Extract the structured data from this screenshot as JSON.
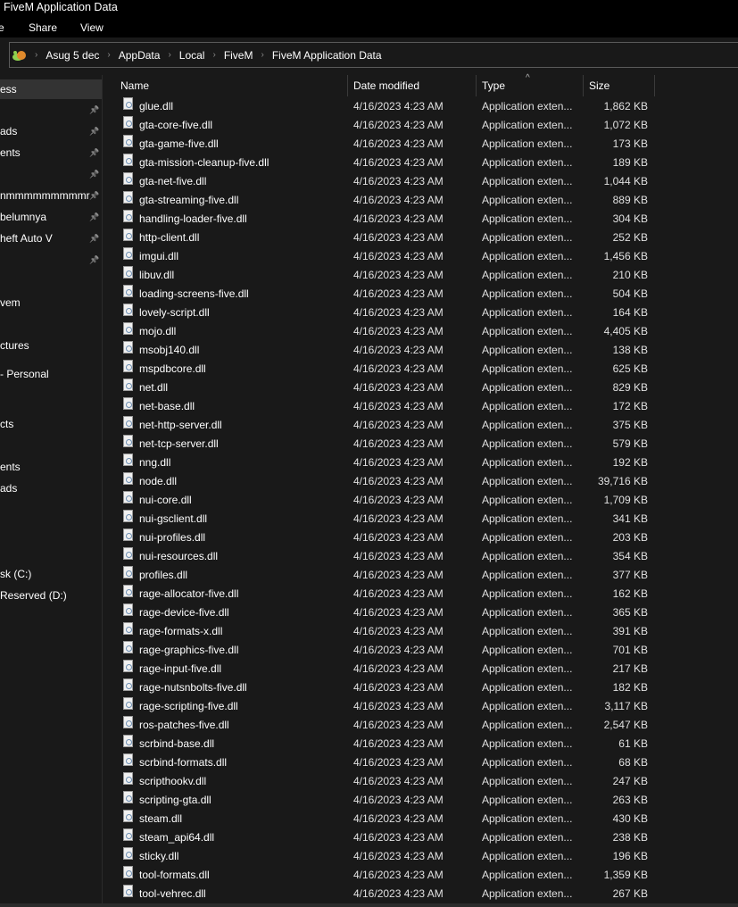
{
  "window": {
    "title": "FiveM Application Data"
  },
  "menu": {
    "file_partial": "e",
    "share": "Share",
    "view": "View"
  },
  "breadcrumb": [
    "Asug 5 dec",
    "AppData",
    "Local",
    "FiveM",
    "FiveM Application Data"
  ],
  "sidebar": {
    "items": [
      {
        "label": "ess",
        "pinned": false,
        "selected": true
      },
      {
        "label": "",
        "pinned": true
      },
      {
        "label": "ads",
        "pinned": true
      },
      {
        "label": "ents",
        "pinned": true
      },
      {
        "label": "",
        "pinned": true
      },
      {
        "label": "nmmmmmmmmmr",
        "pinned": true
      },
      {
        "label": "belumnya",
        "pinned": true
      },
      {
        "label": "heft Auto V",
        "pinned": true
      },
      {
        "label": "",
        "pinned": true
      },
      {
        "label": "vem",
        "pinned": false
      },
      {
        "label": "ctures",
        "pinned": false
      },
      {
        "label": "- Personal",
        "pinned": false
      },
      {
        "label": "cts",
        "pinned": false
      },
      {
        "label": "ents",
        "pinned": false
      },
      {
        "label": "ads",
        "pinned": false
      },
      {
        "label": "sk (C:)",
        "pinned": false
      },
      {
        "label": "Reserved (D:)",
        "pinned": false
      }
    ]
  },
  "columns": {
    "name": "Name",
    "date": "Date modified",
    "type": "Type",
    "size": "Size"
  },
  "files": [
    {
      "name": "glue.dll",
      "date": "4/16/2023 4:23 AM",
      "type": "Application exten...",
      "size": "1,862 KB"
    },
    {
      "name": "gta-core-five.dll",
      "date": "4/16/2023 4:23 AM",
      "type": "Application exten...",
      "size": "1,072 KB"
    },
    {
      "name": "gta-game-five.dll",
      "date": "4/16/2023 4:23 AM",
      "type": "Application exten...",
      "size": "173 KB"
    },
    {
      "name": "gta-mission-cleanup-five.dll",
      "date": "4/16/2023 4:23 AM",
      "type": "Application exten...",
      "size": "189 KB"
    },
    {
      "name": "gta-net-five.dll",
      "date": "4/16/2023 4:23 AM",
      "type": "Application exten...",
      "size": "1,044 KB"
    },
    {
      "name": "gta-streaming-five.dll",
      "date": "4/16/2023 4:23 AM",
      "type": "Application exten...",
      "size": "889 KB"
    },
    {
      "name": "handling-loader-five.dll",
      "date": "4/16/2023 4:23 AM",
      "type": "Application exten...",
      "size": "304 KB"
    },
    {
      "name": "http-client.dll",
      "date": "4/16/2023 4:23 AM",
      "type": "Application exten...",
      "size": "252 KB"
    },
    {
      "name": "imgui.dll",
      "date": "4/16/2023 4:23 AM",
      "type": "Application exten...",
      "size": "1,456 KB"
    },
    {
      "name": "libuv.dll",
      "date": "4/16/2023 4:23 AM",
      "type": "Application exten...",
      "size": "210 KB"
    },
    {
      "name": "loading-screens-five.dll",
      "date": "4/16/2023 4:23 AM",
      "type": "Application exten...",
      "size": "504 KB"
    },
    {
      "name": "lovely-script.dll",
      "date": "4/16/2023 4:23 AM",
      "type": "Application exten...",
      "size": "164 KB"
    },
    {
      "name": "mojo.dll",
      "date": "4/16/2023 4:23 AM",
      "type": "Application exten...",
      "size": "4,405 KB"
    },
    {
      "name": "msobj140.dll",
      "date": "4/16/2023 4:23 AM",
      "type": "Application exten...",
      "size": "138 KB"
    },
    {
      "name": "mspdbcore.dll",
      "date": "4/16/2023 4:23 AM",
      "type": "Application exten...",
      "size": "625 KB"
    },
    {
      "name": "net.dll",
      "date": "4/16/2023 4:23 AM",
      "type": "Application exten...",
      "size": "829 KB"
    },
    {
      "name": "net-base.dll",
      "date": "4/16/2023 4:23 AM",
      "type": "Application exten...",
      "size": "172 KB"
    },
    {
      "name": "net-http-server.dll",
      "date": "4/16/2023 4:23 AM",
      "type": "Application exten...",
      "size": "375 KB"
    },
    {
      "name": "net-tcp-server.dll",
      "date": "4/16/2023 4:23 AM",
      "type": "Application exten...",
      "size": "579 KB"
    },
    {
      "name": "nng.dll",
      "date": "4/16/2023 4:23 AM",
      "type": "Application exten...",
      "size": "192 KB"
    },
    {
      "name": "node.dll",
      "date": "4/16/2023 4:23 AM",
      "type": "Application exten...",
      "size": "39,716 KB"
    },
    {
      "name": "nui-core.dll",
      "date": "4/16/2023 4:23 AM",
      "type": "Application exten...",
      "size": "1,709 KB"
    },
    {
      "name": "nui-gsclient.dll",
      "date": "4/16/2023 4:23 AM",
      "type": "Application exten...",
      "size": "341 KB"
    },
    {
      "name": "nui-profiles.dll",
      "date": "4/16/2023 4:23 AM",
      "type": "Application exten...",
      "size": "203 KB"
    },
    {
      "name": "nui-resources.dll",
      "date": "4/16/2023 4:23 AM",
      "type": "Application exten...",
      "size": "354 KB"
    },
    {
      "name": "profiles.dll",
      "date": "4/16/2023 4:23 AM",
      "type": "Application exten...",
      "size": "377 KB"
    },
    {
      "name": "rage-allocator-five.dll",
      "date": "4/16/2023 4:23 AM",
      "type": "Application exten...",
      "size": "162 KB"
    },
    {
      "name": "rage-device-five.dll",
      "date": "4/16/2023 4:23 AM",
      "type": "Application exten...",
      "size": "365 KB"
    },
    {
      "name": "rage-formats-x.dll",
      "date": "4/16/2023 4:23 AM",
      "type": "Application exten...",
      "size": "391 KB"
    },
    {
      "name": "rage-graphics-five.dll",
      "date": "4/16/2023 4:23 AM",
      "type": "Application exten...",
      "size": "701 KB"
    },
    {
      "name": "rage-input-five.dll",
      "date": "4/16/2023 4:23 AM",
      "type": "Application exten...",
      "size": "217 KB"
    },
    {
      "name": "rage-nutsnbolts-five.dll",
      "date": "4/16/2023 4:23 AM",
      "type": "Application exten...",
      "size": "182 KB"
    },
    {
      "name": "rage-scripting-five.dll",
      "date": "4/16/2023 4:23 AM",
      "type": "Application exten...",
      "size": "3,117 KB"
    },
    {
      "name": "ros-patches-five.dll",
      "date": "4/16/2023 4:23 AM",
      "type": "Application exten...",
      "size": "2,547 KB"
    },
    {
      "name": "scrbind-base.dll",
      "date": "4/16/2023 4:23 AM",
      "type": "Application exten...",
      "size": "61 KB"
    },
    {
      "name": "scrbind-formats.dll",
      "date": "4/16/2023 4:23 AM",
      "type": "Application exten...",
      "size": "68 KB"
    },
    {
      "name": "scripthookv.dll",
      "date": "4/16/2023 4:23 AM",
      "type": "Application exten...",
      "size": "247 KB"
    },
    {
      "name": "scripting-gta.dll",
      "date": "4/16/2023 4:23 AM",
      "type": "Application exten...",
      "size": "263 KB"
    },
    {
      "name": "steam.dll",
      "date": "4/16/2023 4:23 AM",
      "type": "Application exten...",
      "size": "430 KB"
    },
    {
      "name": "steam_api64.dll",
      "date": "4/16/2023 4:23 AM",
      "type": "Application exten...",
      "size": "238 KB"
    },
    {
      "name": "sticky.dll",
      "date": "4/16/2023 4:23 AM",
      "type": "Application exten...",
      "size": "196 KB"
    },
    {
      "name": "tool-formats.dll",
      "date": "4/16/2023 4:23 AM",
      "type": "Application exten...",
      "size": "1,359 KB"
    },
    {
      "name": "tool-vehrec.dll",
      "date": "4/16/2023 4:23 AM",
      "type": "Application exten...",
      "size": "267 KB"
    }
  ]
}
